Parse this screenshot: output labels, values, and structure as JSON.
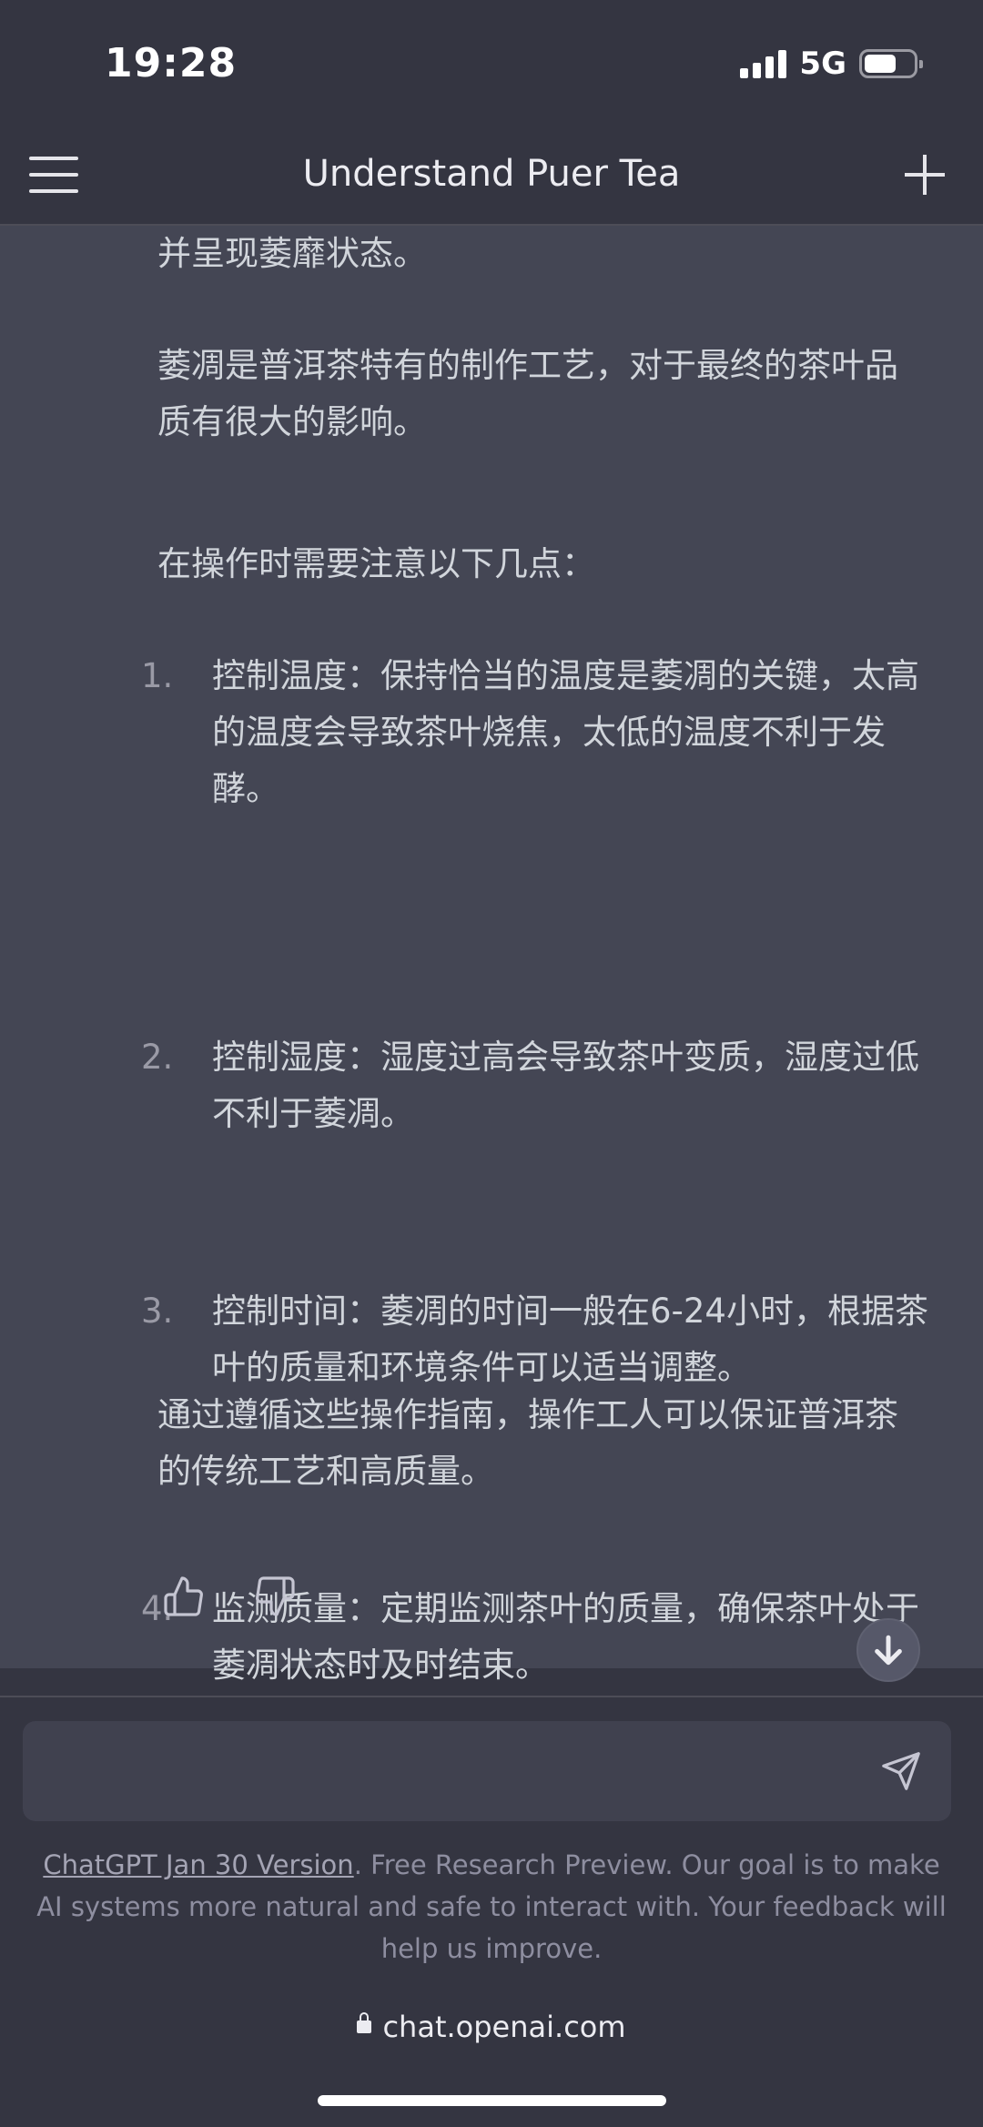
{
  "status_bar": {
    "time": "19:28",
    "network": "5G"
  },
  "header": {
    "title": "Understand Puer Tea"
  },
  "message": {
    "p1": "并呈现萎靡状态。",
    "p2": "萎凋是普洱茶特有的制作工艺，对于最终的茶叶品质有很大的影响。",
    "p3": "在操作时需要注意以下几点：",
    "list": [
      {
        "num": "1.",
        "text": "控制温度：保持恰当的温度是萎凋的关键，太高的温度会导致茶叶烧焦，太低的温度不利于发酵。"
      },
      {
        "num": "2.",
        "text": "控制湿度：湿度过高会导致茶叶变质，湿度过低不利于萎凋。"
      },
      {
        "num": "3.",
        "text": "控制时间：萎凋的时间一般在6-24小时，根据茶叶的质量和环境条件可以适当调整。"
      },
      {
        "num": "4.",
        "text": "监测质量：定期监测茶叶的质量，确保茶叶处于萎凋状态时及时结束。"
      }
    ],
    "p4": "通过遵循这些操作指南，操作工人可以保证普洱茶的传统工艺和高质量。"
  },
  "input": {
    "placeholder": ""
  },
  "footer": {
    "link": "ChatGPT Jan 30 Version",
    "text": ". Free Research Preview. Our goal is to make AI systems more natural and safe to interact with. Your feedback will help us improve."
  },
  "browser": {
    "url": "chat.openai.com"
  },
  "icons": [
    "menu-icon",
    "plus-icon",
    "thumbs-up-icon",
    "thumbs-down-icon",
    "arrow-down-icon",
    "send-icon",
    "lock-icon"
  ]
}
